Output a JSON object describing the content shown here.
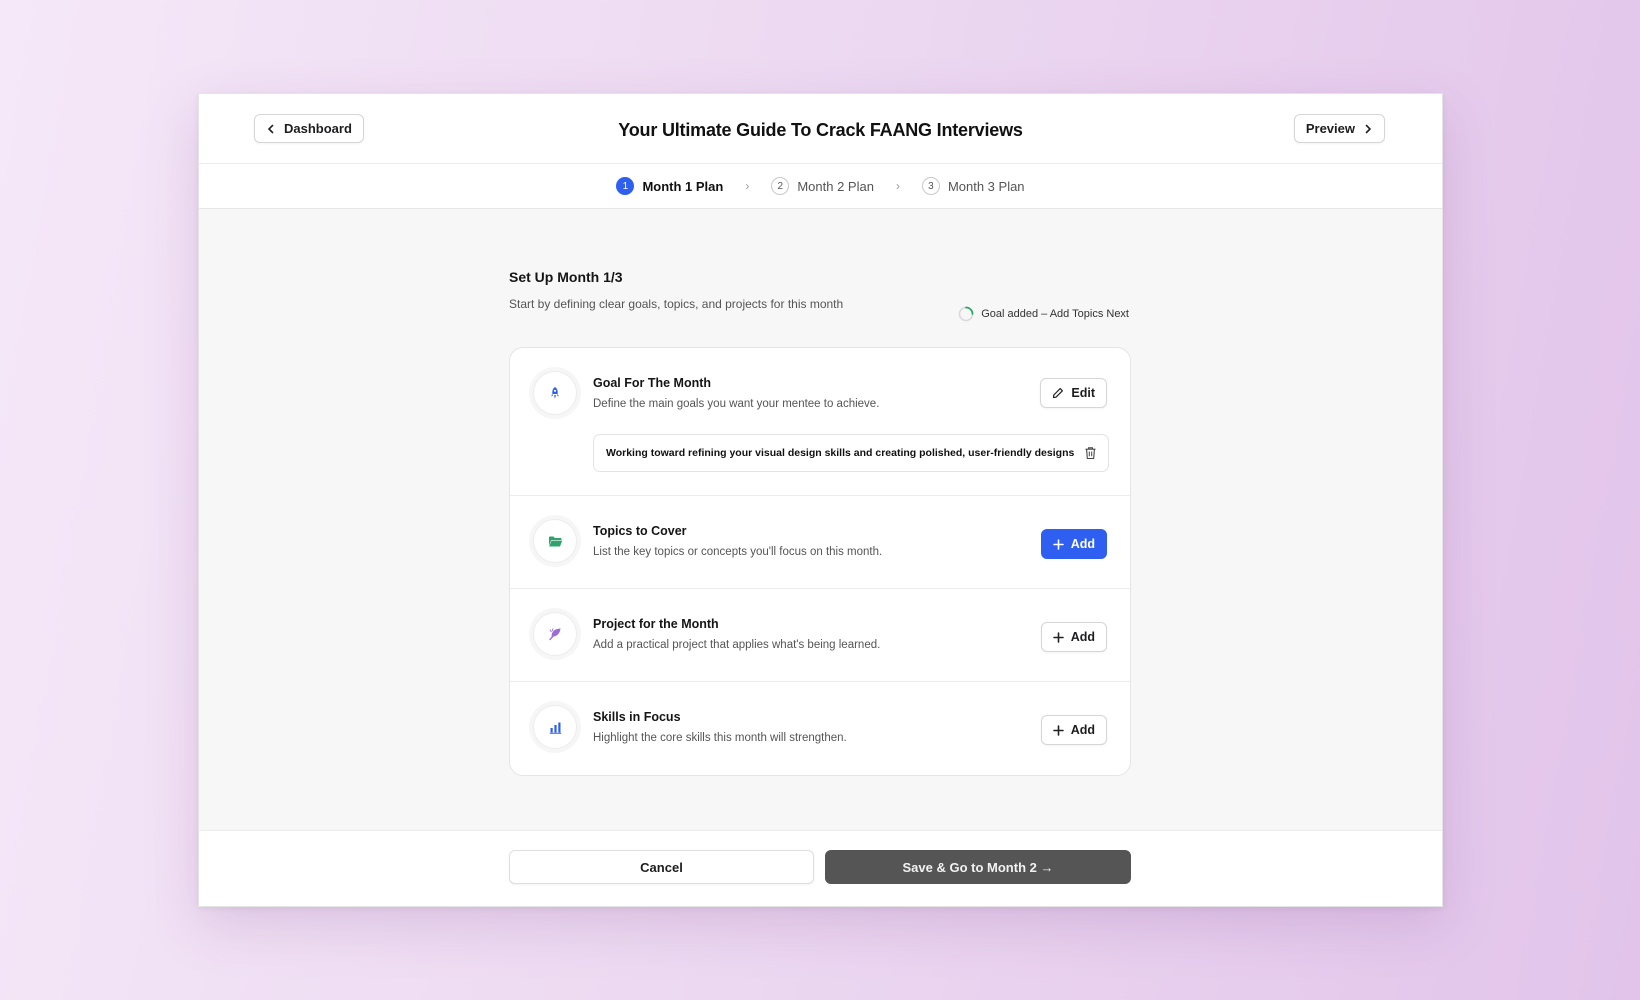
{
  "header": {
    "back_label": "Dashboard",
    "title": "Your Ultimate Guide To Crack FAANG Interviews",
    "preview_label": "Preview"
  },
  "stepper": {
    "steps": [
      {
        "num": "1",
        "label": "Month 1 Plan",
        "active": true
      },
      {
        "num": "2",
        "label": "Month 2 Plan",
        "active": false
      },
      {
        "num": "3",
        "label": "Month 3 Plan",
        "active": false
      }
    ]
  },
  "setup": {
    "title": "Set Up Month 1/3",
    "subtitle": "Start by defining clear goals, topics, and projects for this month",
    "status": "Goal added – Add Topics Next"
  },
  "sections": {
    "goal": {
      "title": "Goal For The Month",
      "desc": "Define the main goals you want your mentee to achieve.",
      "button": "Edit",
      "value": "Working toward refining your visual design skills and creating polished, user-friendly designs"
    },
    "topics": {
      "title": "Topics to Cover",
      "desc": "List the key topics or concepts you'll focus on this month.",
      "button": "Add"
    },
    "project": {
      "title": "Project for the Month",
      "desc": "Add a practical project that applies what's being learned.",
      "button": "Add"
    },
    "skills": {
      "title": "Skills in Focus",
      "desc": "Highlight the core skills this month will strengthen.",
      "button": "Add"
    }
  },
  "footer": {
    "cancel_label": "Cancel",
    "save_label": "Save & Go to Month 2 →"
  },
  "icons": {
    "back": "chevron-left-icon",
    "preview": "chevron-right-icon",
    "goal": "rocket-icon",
    "topics": "folder-icon",
    "project": "leaf-icon",
    "skills": "bar-chart-icon",
    "edit": "pencil-icon",
    "add": "plus-icon",
    "delete": "trash-icon",
    "status": "progress-ring-icon"
  },
  "colors": {
    "accent": "#2f5ff0",
    "topics_icon": "#2fa36b",
    "project_icon": "#9b6bd6",
    "save_button": "#555555",
    "status_progress": "#2fa36b"
  }
}
